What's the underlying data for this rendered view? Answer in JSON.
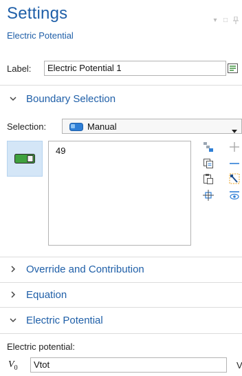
{
  "header": {
    "title": "Settings",
    "subtitle": "Electric Potential"
  },
  "label_row": {
    "label": "Label:",
    "value": "Electric Potential 1"
  },
  "sections": {
    "boundary_selection": "Boundary Selection",
    "override": "Override and Contribution",
    "equation": "Equation",
    "electric_potential": "Electric Potential"
  },
  "selection": {
    "label": "Selection:",
    "value": "Manual",
    "items": [
      "49"
    ]
  },
  "electric_potential": {
    "field_label": "Electric potential:",
    "symbol": "V",
    "symbol_sub": "0",
    "value": "Vtot",
    "unit": "V"
  },
  "colors": {
    "accent": "#1f5fa8",
    "active_bg": "#d4e6f7",
    "toggle_green": "#3fa13f"
  },
  "icons": {
    "window": [
      "minimize-icon",
      "maximize-icon",
      "pin-icon"
    ],
    "toolbar": [
      "paste-selection-icon",
      "add-to-selection-icon",
      "copy-icon",
      "remove-from-selection-icon",
      "paste-icon",
      "clear-selection-icon",
      "zoom-to-selection-icon",
      "show-selection-icon"
    ]
  }
}
